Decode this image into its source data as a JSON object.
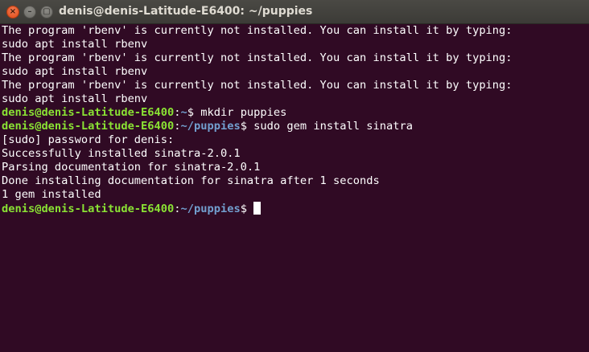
{
  "window": {
    "title": "denis@denis-Latitude-E6400: ~/puppies",
    "buttons": {
      "close": "×",
      "minimize": "–",
      "maximize": "▢"
    }
  },
  "terminal": {
    "lines": [
      {
        "type": "output",
        "text": "The program 'rbenv' is currently not installed. You can install it by typing:"
      },
      {
        "type": "output",
        "text": "sudo apt install rbenv"
      },
      {
        "type": "output",
        "text": "The program 'rbenv' is currently not installed. You can install it by typing:"
      },
      {
        "type": "output",
        "text": "sudo apt install rbenv"
      },
      {
        "type": "output",
        "text": "The program 'rbenv' is currently not installed. You can install it by typing:"
      },
      {
        "type": "output",
        "text": "sudo apt install rbenv"
      },
      {
        "type": "prompt",
        "user": "denis@denis-Latitude-E6400",
        "sep": ":",
        "path": "~",
        "symbol": "$ ",
        "command": "mkdir puppies"
      },
      {
        "type": "prompt",
        "user": "denis@denis-Latitude-E6400",
        "sep": ":",
        "path": "~/puppies",
        "symbol": "$ ",
        "command": "sudo gem install sinatra"
      },
      {
        "type": "output",
        "text": "[sudo] password for denis:"
      },
      {
        "type": "output",
        "text": "Successfully installed sinatra-2.0.1"
      },
      {
        "type": "output",
        "text": "Parsing documentation for sinatra-2.0.1"
      },
      {
        "type": "output",
        "text": "Done installing documentation for sinatra after 1 seconds"
      },
      {
        "type": "output",
        "text": "1 gem installed"
      },
      {
        "type": "prompt",
        "user": "denis@denis-Latitude-E6400",
        "sep": ":",
        "path": "~/puppies",
        "symbol": "$ ",
        "command": "",
        "cursor": true
      }
    ]
  },
  "colors": {
    "background": "#300a24",
    "prompt_user": "#8ae234",
    "prompt_path": "#729fcf",
    "text": "#ffffff"
  }
}
